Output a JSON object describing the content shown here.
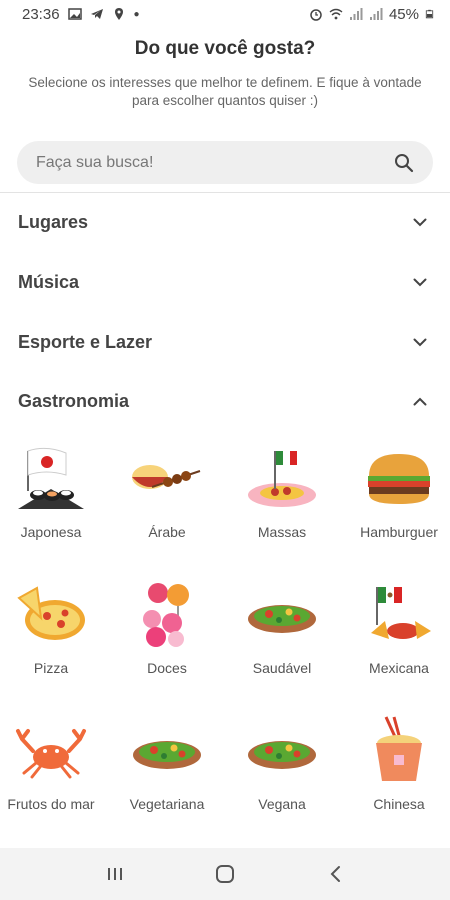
{
  "status_bar": {
    "time": "23:36",
    "battery": "45%"
  },
  "header": {
    "title": "Do que você gosta?",
    "subtitle": "Selecione os interesses que melhor te definem. E fique à vontade para escolher quantos quiser :)"
  },
  "search": {
    "placeholder": "Faça sua busca!"
  },
  "sections": [
    {
      "title": "Lugares",
      "expanded": false
    },
    {
      "title": "Música",
      "expanded": false
    },
    {
      "title": "Esporte e Lazer",
      "expanded": false
    },
    {
      "title": "Gastronomia",
      "expanded": true
    }
  ],
  "gastronomia": [
    {
      "label": "Japonesa",
      "icon": "sushi-japan-flag-icon"
    },
    {
      "label": "Árabe",
      "icon": "kebab-rice-icon"
    },
    {
      "label": "Massas",
      "icon": "pasta-italy-flag-icon"
    },
    {
      "label": "Hamburguer",
      "icon": "hamburger-icon"
    },
    {
      "label": "Pizza",
      "icon": "pizza-icon"
    },
    {
      "label": "Doces",
      "icon": "sweets-icon"
    },
    {
      "label": "Saudável",
      "icon": "salad-icon"
    },
    {
      "label": "Mexicana",
      "icon": "nachos-mexico-flag-icon"
    },
    {
      "label": "Frutos do mar",
      "icon": "crab-icon"
    },
    {
      "label": "Vegetariana",
      "icon": "vegetable-salad-icon"
    },
    {
      "label": "Vegana",
      "icon": "vegan-salad-icon"
    },
    {
      "label": "Chinesa",
      "icon": "chinese-takeout-icon"
    }
  ],
  "colors": {
    "accent_text": "#333333",
    "search_bg": "#efefef",
    "navbar_bg": "#f3f3f3"
  }
}
